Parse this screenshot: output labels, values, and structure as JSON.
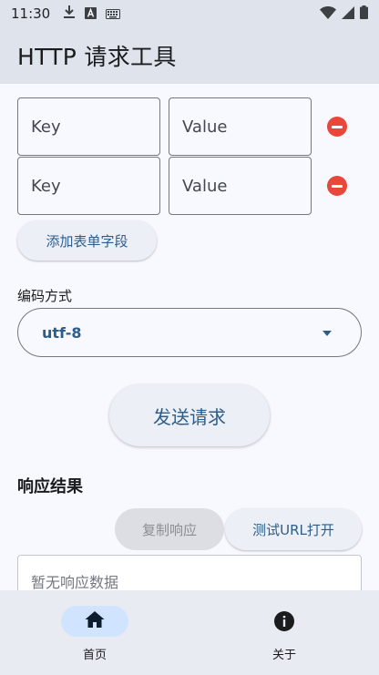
{
  "status_bar": {
    "time": "11:30",
    "left_icons": [
      "download-icon",
      "a-box-icon",
      "keyboard-icon"
    ],
    "right_icons": [
      "wifi-icon",
      "signal-icon",
      "battery-icon"
    ]
  },
  "app_bar": {
    "title": "HTTP 请求工具"
  },
  "form_fields": {
    "rows": [
      {
        "key_placeholder": "Key",
        "value_placeholder": "Value"
      },
      {
        "key_placeholder": "Key",
        "value_placeholder": "Value"
      }
    ],
    "add_button": "添加表单字段"
  },
  "encoding": {
    "label": "编码方式",
    "selected": "utf-8"
  },
  "send_button": "发送请求",
  "response": {
    "title": "响应结果",
    "copy_button": "复制响应",
    "test_url_button": "测试URL打开",
    "placeholder": "暂无响应数据"
  },
  "bottom_nav": {
    "items": [
      {
        "label": "首页",
        "icon": "home-icon",
        "active": true
      },
      {
        "label": "关于",
        "icon": "info-icon",
        "active": false
      }
    ]
  },
  "colors": {
    "accent": "#2e5d8a",
    "remove": "#e8473a",
    "active_indicator": "#d1e4ff"
  }
}
